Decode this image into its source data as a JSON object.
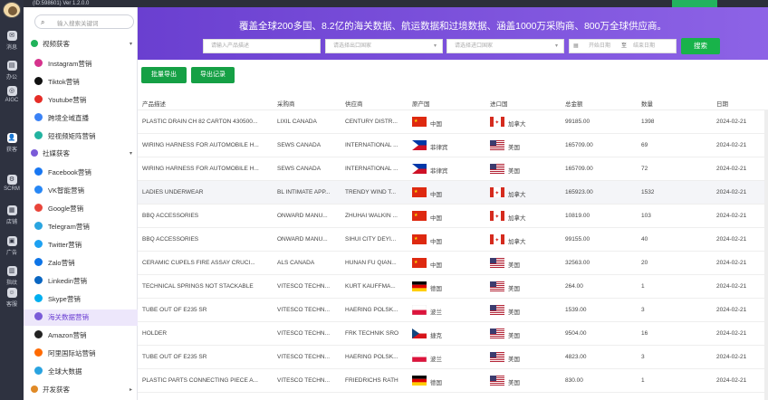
{
  "topbar": {
    "version": "(ID:598601)  Ver 1.2.0.0",
    "right_button": ""
  },
  "rail": [
    {
      "label": "消息",
      "glyph": "✉"
    },
    {
      "label": "办公",
      "glyph": "▤"
    },
    {
      "label": "AIGC",
      "glyph": "◎"
    },
    {
      "label": "获客",
      "glyph": "👤"
    },
    {
      "label": "SCRM",
      "glyph": "⚙"
    },
    {
      "label": "店铺",
      "glyph": "▦"
    },
    {
      "label": "广告",
      "glyph": "▣"
    },
    {
      "label": "指纹",
      "glyph": "▥"
    },
    {
      "label": "客服",
      "glyph": "☺"
    }
  ],
  "sidebar": {
    "search_placeholder": "输入搜索关键词",
    "sections": [
      {
        "label": "视频获客",
        "color": "#20b25a"
      },
      {
        "label": "社媒获客",
        "color": "#7a5bd8"
      },
      {
        "label": "开发获客",
        "color": "#e08a27"
      }
    ],
    "video_items": [
      {
        "label": "Instagram营销",
        "color": "#d6338d"
      },
      {
        "label": "Tiktok营销",
        "color": "#111111"
      },
      {
        "label": "Youtube营销",
        "color": "#e52d27"
      },
      {
        "label": "跨境全域直播",
        "color": "#3a82f6"
      },
      {
        "label": "短视频矩阵营销",
        "color": "#22b3a0"
      }
    ],
    "social_items": [
      {
        "label": "Facebook营销",
        "color": "#1877f2"
      },
      {
        "label": "VK智能营销",
        "color": "#2787f5"
      },
      {
        "label": "Google营销",
        "color": "#e9453a"
      },
      {
        "label": "Telegram营销",
        "color": "#2aa5e0"
      },
      {
        "label": "Twitter营销",
        "color": "#1da1f2"
      },
      {
        "label": "Zalo营销",
        "color": "#0d74e7"
      },
      {
        "label": "Linkedin营销",
        "color": "#0a66c2"
      },
      {
        "label": "Skype营销",
        "color": "#00aff0"
      },
      {
        "label": "海关数据营销",
        "color": "#7a5bd8"
      },
      {
        "label": "Amazon营销",
        "color": "#222222"
      },
      {
        "label": "阿里国际站营销",
        "color": "#ff6a00"
      },
      {
        "label": "全球大数据",
        "color": "#29a3e0"
      }
    ]
  },
  "banner": {
    "slogan": "覆盖全球200多国、8.2亿的海关数据、航运数据和过境数据、涵盖1000万采购商、800万全球供应商。",
    "product_placeholder": "请输入产品描述",
    "exporter_placeholder": "请选择出口国家",
    "importer_placeholder": "请选择进口国家",
    "start_date": "开始日期",
    "date_sep": "至",
    "end_date": "结束日期",
    "search_label": "搜索"
  },
  "actions": {
    "batch_export": "批量导出",
    "export_log": "导出记录"
  },
  "table": {
    "headers": [
      "产品描述",
      "采购商",
      "供应商",
      "原产国",
      "进口国",
      "总金额",
      "数量",
      "日期"
    ],
    "rows": [
      {
        "desc": "PLASTIC DRAIN CH 82 CARTON 430500...",
        "buyer": "LIXIL CANADA",
        "supplier": "CENTURY DISTR...",
        "origin": "中国",
        "origin_flag": "cn",
        "dest": "加拿大",
        "dest_flag": "ca",
        "amount": "99185.00",
        "qty": "1398",
        "date": "2024-02-21"
      },
      {
        "desc": "WIRING HARNESS FOR AUTOMOBILE H...",
        "buyer": "SEWS CANADA",
        "supplier": "INTERNATIONAL ...",
        "origin": "菲律宾",
        "origin_flag": "ph",
        "dest": "美国",
        "dest_flag": "us",
        "amount": "165709.00",
        "qty": "69",
        "date": "2024-02-21"
      },
      {
        "desc": "WIRING HARNESS FOR AUTOMOBILE H...",
        "buyer": "SEWS CANADA",
        "supplier": "INTERNATIONAL ...",
        "origin": "菲律宾",
        "origin_flag": "ph",
        "dest": "美国",
        "dest_flag": "us",
        "amount": "165709.00",
        "qty": "72",
        "date": "2024-02-21"
      },
      {
        "desc": "LADIES UNDERWEAR",
        "buyer": "BL INTIMATE APP...",
        "supplier": "TRENDY WIND T...",
        "origin": "中国",
        "origin_flag": "cn",
        "dest": "加拿大",
        "dest_flag": "ca",
        "amount": "165923.00",
        "qty": "1532",
        "date": "2024-02-21"
      },
      {
        "desc": "BBQ ACCESSORIES",
        "buyer": "ONWARD MANU...",
        "supplier": "ZHUHAI WALKIN ...",
        "origin": "中国",
        "origin_flag": "cn",
        "dest": "加拿大",
        "dest_flag": "ca",
        "amount": "10819.00",
        "qty": "103",
        "date": "2024-02-21"
      },
      {
        "desc": "BBQ ACCESSORIES",
        "buyer": "ONWARD MANU...",
        "supplier": "SIHUI CITY DEYI...",
        "origin": "中国",
        "origin_flag": "cn",
        "dest": "加拿大",
        "dest_flag": "ca",
        "amount": "99155.00",
        "qty": "40",
        "date": "2024-02-21"
      },
      {
        "desc": "CERAMIC CUPELS FIRE ASSAY CRUCI...",
        "buyer": "ALS CANADA",
        "supplier": "HUNAN FU QIAN...",
        "origin": "中国",
        "origin_flag": "cn",
        "dest": "美国",
        "dest_flag": "us",
        "amount": "32563.00",
        "qty": "20",
        "date": "2024-02-21"
      },
      {
        "desc": "TECHNICAL SPRINGS NOT STACKABLE",
        "buyer": "VITESCO TECHN...",
        "supplier": "KURT KAUFFMA...",
        "origin": "德国",
        "origin_flag": "de",
        "dest": "美国",
        "dest_flag": "us",
        "amount": "264.00",
        "qty": "1",
        "date": "2024-02-21"
      },
      {
        "desc": "TUBE OUT OF E235 SR",
        "buyer": "VITESCO TECHN...",
        "supplier": "HAERING POLSK...",
        "origin": "波兰",
        "origin_flag": "pl",
        "dest": "美国",
        "dest_flag": "us",
        "amount": "1539.00",
        "qty": "3",
        "date": "2024-02-21"
      },
      {
        "desc": "HOLDER",
        "buyer": "VITESCO TECHN...",
        "supplier": "FRK TECHNIK SRO",
        "origin": "捷克",
        "origin_flag": "cz",
        "dest": "美国",
        "dest_flag": "us",
        "amount": "9504.00",
        "qty": "16",
        "date": "2024-02-21"
      },
      {
        "desc": "TUBE OUT OF E235 SR",
        "buyer": "VITESCO TECHN...",
        "supplier": "HAERING POLSK...",
        "origin": "波兰",
        "origin_flag": "pl",
        "dest": "美国",
        "dest_flag": "us",
        "amount": "4823.00",
        "qty": "3",
        "date": "2024-02-21"
      },
      {
        "desc": "PLASTIC PARTS CONNECTING PIECE A...",
        "buyer": "VITESCO TECHN...",
        "supplier": "FRIEDRICHS RATH",
        "origin": "德国",
        "origin_flag": "de",
        "dest": "美国",
        "dest_flag": "us",
        "amount": "830.00",
        "qty": "1",
        "date": "2024-02-21"
      }
    ]
  }
}
